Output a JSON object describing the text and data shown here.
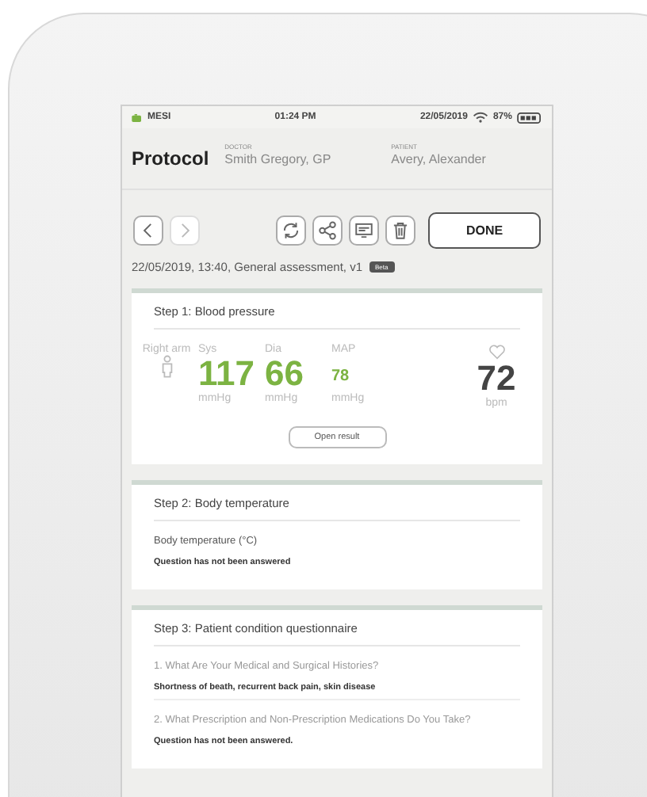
{
  "status_bar": {
    "carrier": "MESI",
    "time": "01:24 PM",
    "date": "22/05/2019",
    "battery": "87%"
  },
  "header": {
    "title": "Protocol",
    "doctor_label": "DOCTOR",
    "doctor": "Smith Gregory, GP",
    "patient_label": "PATIENT",
    "patient": "Avery, Alexander"
  },
  "toolbar": {
    "buttons": [
      {
        "kind": "back",
        "disabled": false
      },
      {
        "kind": "forward",
        "disabled": true
      },
      {
        "kind": "sync",
        "disabled": false
      },
      {
        "kind": "share",
        "disabled": false
      },
      {
        "kind": "display",
        "disabled": false
      },
      {
        "kind": "delete",
        "disabled": false
      }
    ],
    "done": "DONE"
  },
  "info": {
    "text": "22/05/2019, 13:40, General assessment, v1",
    "badge": "Beta"
  },
  "steps": [
    {
      "kind": "blood_pressure",
      "title": "Step 1: Blood pressure",
      "side": "Right arm",
      "readings": [
        {
          "label": "Sys",
          "value": "117",
          "unit": "mmHg",
          "kind": "primary"
        },
        {
          "label": "Dia",
          "value": "66",
          "unit": "mmHg",
          "kind": "primary"
        },
        {
          "label": "MAP",
          "value": "78",
          "unit": "mmHg",
          "kind": "secondary"
        }
      ],
      "pulse": {
        "value": "72",
        "unit": "bpm"
      },
      "button": "Open result"
    },
    {
      "kind": "questions",
      "title": "Step 2: Body temperature",
      "questions": [
        {
          "question": "Body temperature (°C)",
          "answer": "Question has not been answered"
        }
      ]
    },
    {
      "kind": "questions",
      "title": "Step 3: Patient condition questionnaire",
      "questions": [
        {
          "question": "1. What Are Your Medical and Surgical Histories?",
          "answer": "Shortness of beath, recurrent back pain, skin disease"
        },
        {
          "question": "2. What Prescription and Non-Prescription Medications Do You Take?",
          "answer": "Question has not been answered."
        }
      ]
    }
  ]
}
